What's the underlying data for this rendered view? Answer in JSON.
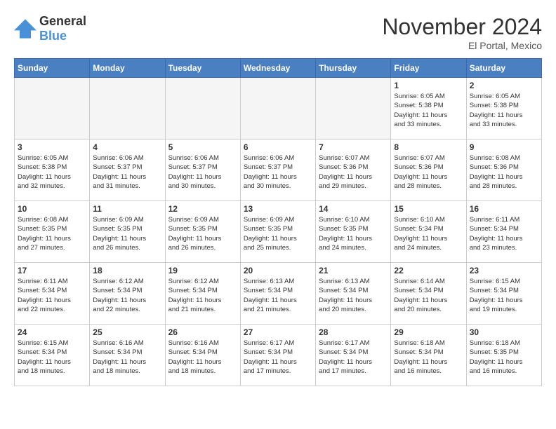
{
  "logo": {
    "general": "General",
    "blue": "Blue"
  },
  "header": {
    "month": "November 2024",
    "location": "El Portal, Mexico"
  },
  "weekdays": [
    "Sunday",
    "Monday",
    "Tuesday",
    "Wednesday",
    "Thursday",
    "Friday",
    "Saturday"
  ],
  "weeks": [
    [
      {
        "day": "",
        "info": ""
      },
      {
        "day": "",
        "info": ""
      },
      {
        "day": "",
        "info": ""
      },
      {
        "day": "",
        "info": ""
      },
      {
        "day": "",
        "info": ""
      },
      {
        "day": "1",
        "info": "Sunrise: 6:05 AM\nSunset: 5:38 PM\nDaylight: 11 hours\nand 33 minutes."
      },
      {
        "day": "2",
        "info": "Sunrise: 6:05 AM\nSunset: 5:38 PM\nDaylight: 11 hours\nand 33 minutes."
      }
    ],
    [
      {
        "day": "3",
        "info": "Sunrise: 6:05 AM\nSunset: 5:38 PM\nDaylight: 11 hours\nand 32 minutes."
      },
      {
        "day": "4",
        "info": "Sunrise: 6:06 AM\nSunset: 5:37 PM\nDaylight: 11 hours\nand 31 minutes."
      },
      {
        "day": "5",
        "info": "Sunrise: 6:06 AM\nSunset: 5:37 PM\nDaylight: 11 hours\nand 30 minutes."
      },
      {
        "day": "6",
        "info": "Sunrise: 6:06 AM\nSunset: 5:37 PM\nDaylight: 11 hours\nand 30 minutes."
      },
      {
        "day": "7",
        "info": "Sunrise: 6:07 AM\nSunset: 5:36 PM\nDaylight: 11 hours\nand 29 minutes."
      },
      {
        "day": "8",
        "info": "Sunrise: 6:07 AM\nSunset: 5:36 PM\nDaylight: 11 hours\nand 28 minutes."
      },
      {
        "day": "9",
        "info": "Sunrise: 6:08 AM\nSunset: 5:36 PM\nDaylight: 11 hours\nand 28 minutes."
      }
    ],
    [
      {
        "day": "10",
        "info": "Sunrise: 6:08 AM\nSunset: 5:35 PM\nDaylight: 11 hours\nand 27 minutes."
      },
      {
        "day": "11",
        "info": "Sunrise: 6:09 AM\nSunset: 5:35 PM\nDaylight: 11 hours\nand 26 minutes."
      },
      {
        "day": "12",
        "info": "Sunrise: 6:09 AM\nSunset: 5:35 PM\nDaylight: 11 hours\nand 26 minutes."
      },
      {
        "day": "13",
        "info": "Sunrise: 6:09 AM\nSunset: 5:35 PM\nDaylight: 11 hours\nand 25 minutes."
      },
      {
        "day": "14",
        "info": "Sunrise: 6:10 AM\nSunset: 5:35 PM\nDaylight: 11 hours\nand 24 minutes."
      },
      {
        "day": "15",
        "info": "Sunrise: 6:10 AM\nSunset: 5:34 PM\nDaylight: 11 hours\nand 24 minutes."
      },
      {
        "day": "16",
        "info": "Sunrise: 6:11 AM\nSunset: 5:34 PM\nDaylight: 11 hours\nand 23 minutes."
      }
    ],
    [
      {
        "day": "17",
        "info": "Sunrise: 6:11 AM\nSunset: 5:34 PM\nDaylight: 11 hours\nand 22 minutes."
      },
      {
        "day": "18",
        "info": "Sunrise: 6:12 AM\nSunset: 5:34 PM\nDaylight: 11 hours\nand 22 minutes."
      },
      {
        "day": "19",
        "info": "Sunrise: 6:12 AM\nSunset: 5:34 PM\nDaylight: 11 hours\nand 21 minutes."
      },
      {
        "day": "20",
        "info": "Sunrise: 6:13 AM\nSunset: 5:34 PM\nDaylight: 11 hours\nand 21 minutes."
      },
      {
        "day": "21",
        "info": "Sunrise: 6:13 AM\nSunset: 5:34 PM\nDaylight: 11 hours\nand 20 minutes."
      },
      {
        "day": "22",
        "info": "Sunrise: 6:14 AM\nSunset: 5:34 PM\nDaylight: 11 hours\nand 20 minutes."
      },
      {
        "day": "23",
        "info": "Sunrise: 6:15 AM\nSunset: 5:34 PM\nDaylight: 11 hours\nand 19 minutes."
      }
    ],
    [
      {
        "day": "24",
        "info": "Sunrise: 6:15 AM\nSunset: 5:34 PM\nDaylight: 11 hours\nand 18 minutes."
      },
      {
        "day": "25",
        "info": "Sunrise: 6:16 AM\nSunset: 5:34 PM\nDaylight: 11 hours\nand 18 minutes."
      },
      {
        "day": "26",
        "info": "Sunrise: 6:16 AM\nSunset: 5:34 PM\nDaylight: 11 hours\nand 18 minutes."
      },
      {
        "day": "27",
        "info": "Sunrise: 6:17 AM\nSunset: 5:34 PM\nDaylight: 11 hours\nand 17 minutes."
      },
      {
        "day": "28",
        "info": "Sunrise: 6:17 AM\nSunset: 5:34 PM\nDaylight: 11 hours\nand 17 minutes."
      },
      {
        "day": "29",
        "info": "Sunrise: 6:18 AM\nSunset: 5:34 PM\nDaylight: 11 hours\nand 16 minutes."
      },
      {
        "day": "30",
        "info": "Sunrise: 6:18 AM\nSunset: 5:35 PM\nDaylight: 11 hours\nand 16 minutes."
      }
    ]
  ]
}
